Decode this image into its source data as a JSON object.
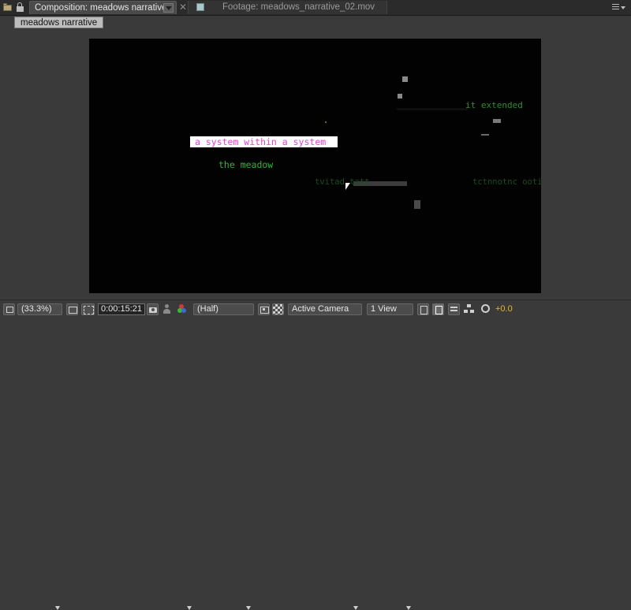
{
  "tabs": {
    "active": {
      "label": "Composition: meadows narrative"
    },
    "inactive": {
      "label": "Footage: meadows_narrative_02.mov"
    }
  },
  "breadcrumb": {
    "label": "meadows narrative"
  },
  "viewer": {
    "title_text": "a system within a system",
    "subtitle_text": "the meadow",
    "extended_text": "it extended",
    "ghost_text_left": "tvitad.tatt",
    "ghost_text_right": "tctnnotnc ooti"
  },
  "toolbar": {
    "zoom": "(33.3%)",
    "timecode": "0:00:15:21",
    "resolution": "(Half)",
    "camera": "Active Camera",
    "views": "1 View",
    "exposure": "+0.0"
  },
  "colors": {
    "title_text": "#e042d6",
    "subtitle_text": "#2fb838",
    "exposure": "#e8b62e"
  }
}
